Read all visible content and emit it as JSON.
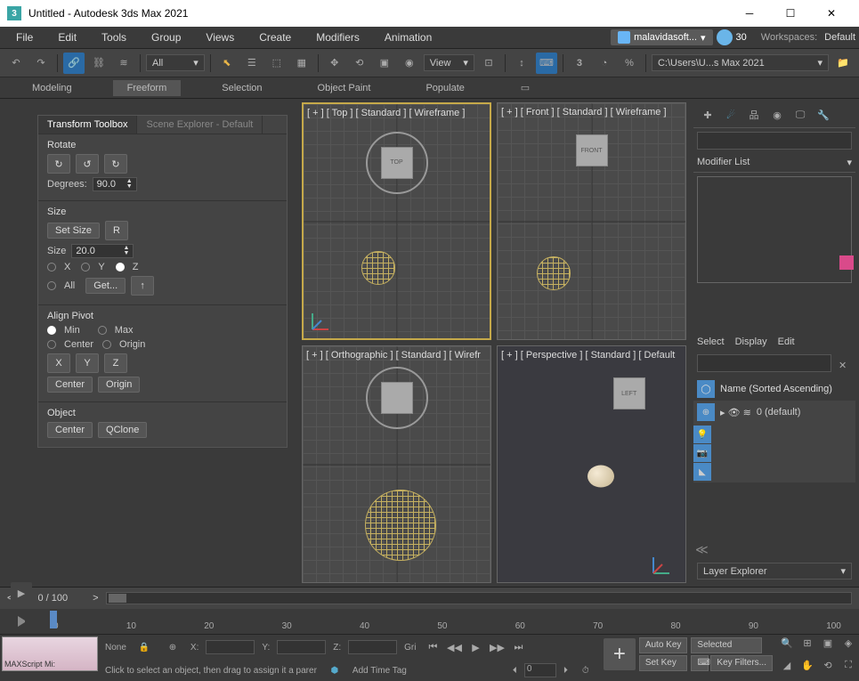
{
  "title": "Untitled - Autodesk 3ds Max 2021",
  "menu": [
    "File",
    "Edit",
    "Tools",
    "Group",
    "Views",
    "Create",
    "Modifiers",
    "Animation"
  ],
  "user": "malavidasoft...",
  "time_badge": "30",
  "workspaces_label": "Workspaces:",
  "workspaces_value": "Default",
  "toolbar1": {
    "all_dropdown": "All",
    "view_dropdown": "View",
    "path_label": "C:\\Users\\U...s Max 2021"
  },
  "ribbon_tabs": [
    "Modeling",
    "Freeform",
    "Selection",
    "Object Paint",
    "Populate"
  ],
  "transform_panel": {
    "tab1": "Transform Toolbox",
    "tab2": "Scene Explorer - Default",
    "rotate_label": "Rotate",
    "degrees_label": "Degrees:",
    "degrees_value": "90.0",
    "size_label": "Size",
    "set_size": "Set Size",
    "r_btn": "R",
    "size_field_label": "Size",
    "size_value": "20.0",
    "x": "X",
    "y": "Y",
    "z": "Z",
    "all": "All",
    "get": "Get...",
    "align_label": "Align Pivot",
    "min": "Min",
    "max": "Max",
    "center": "Center",
    "origin": "Origin",
    "object_label": "Object",
    "qclone": "QClone"
  },
  "viewports": {
    "top": "[ + ] [ Top ] [ Standard ] [ Wireframe ]",
    "front": "[ + ] [ Front ] [ Standard ] [ Wireframe ]",
    "ortho": "[ + ] [ Orthographic ] [ Standard ] [ Wirefr",
    "persp": "[ + ] [ Perspective ] [ Standard ] [ Default",
    "cube_top": "TOP",
    "cube_front": "FRONT",
    "cube_left": "LEFT"
  },
  "right": {
    "modifier_list": "Modifier List",
    "tabs": [
      "Select",
      "Display",
      "Edit"
    ],
    "name_header": "Name (Sorted Ascending)",
    "default_layer": "0 (default)",
    "layer_explorer": "Layer Explorer"
  },
  "timeline": {
    "frame": "0 / 100",
    "ticks": [
      "0",
      "10",
      "20",
      "30",
      "40",
      "50",
      "60",
      "70",
      "80",
      "90",
      "100"
    ]
  },
  "status": {
    "maxscript": "MAXScript Mi:",
    "none": "None",
    "x": "X:",
    "y": "Y:",
    "z": "Z:",
    "grid": "Gri",
    "hint": "Click to select an object, then drag to assign it a parer",
    "add_tag": "Add Time Tag",
    "autokey": "Auto Key",
    "setkey": "Set Key",
    "selected": "Selected",
    "keyfilters": "Key Filters...",
    "frame0": "0"
  }
}
